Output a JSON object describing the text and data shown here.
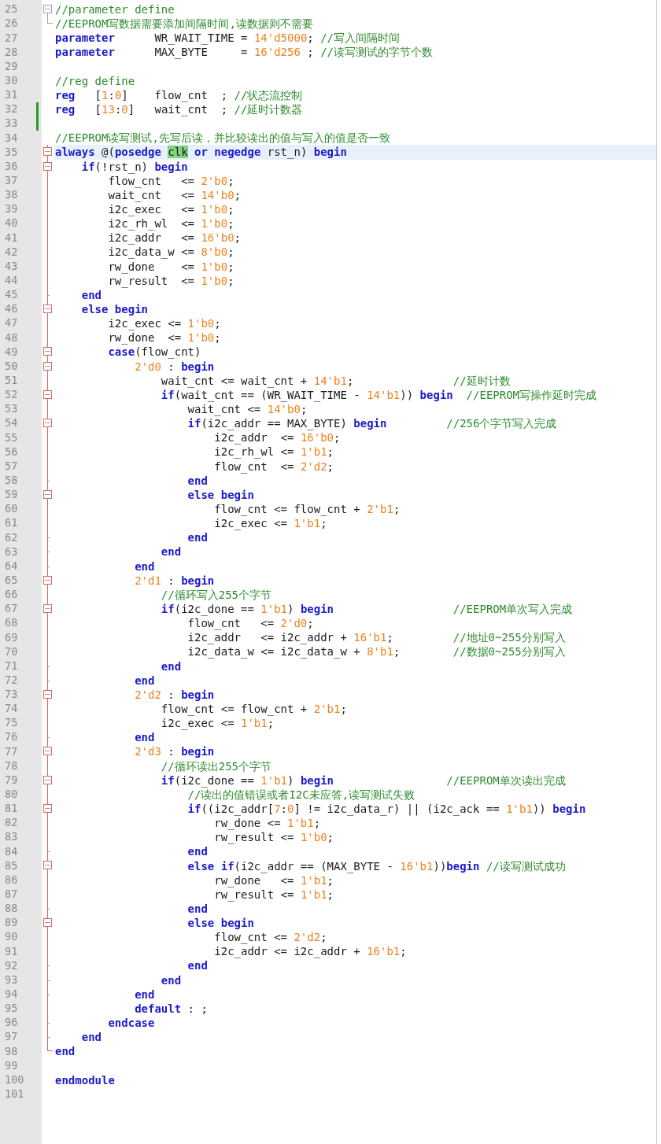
{
  "lines": [
    {
      "number": "25",
      "fold": {
        "kind": "box",
        "active": false
      },
      "changed": false,
      "current": false,
      "tokens": [
        {
          "kind": "comment",
          "text": "//parameter define"
        }
      ]
    },
    {
      "number": "26",
      "fold": {
        "kind": "corner",
        "active": false
      },
      "changed": false,
      "current": false,
      "tokens": [
        {
          "kind": "comment",
          "text": "//EEPROM写数据需要添加间隔时间,读数据则不需要"
        }
      ]
    },
    {
      "number": "27",
      "changed": false,
      "current": false,
      "tokens": [
        {
          "kind": "keyword",
          "text": "parameter"
        },
        {
          "kind": "plain",
          "text": "      WR_WAIT_TIME = "
        },
        {
          "kind": "number",
          "text": "14'd5000"
        },
        {
          "kind": "plain",
          "text": ";"
        },
        {
          "kind": "comment",
          "text": " //写入间隔时间"
        }
      ]
    },
    {
      "number": "28",
      "changed": false,
      "current": false,
      "tokens": [
        {
          "kind": "keyword",
          "text": "parameter"
        },
        {
          "kind": "plain",
          "text": "      MAX_BYTE     = "
        },
        {
          "kind": "number",
          "text": "16'd256"
        },
        {
          "kind": "plain",
          "text": " ;"
        },
        {
          "kind": "comment",
          "text": " //读写测试的字节个数"
        }
      ]
    },
    {
      "number": "29",
      "changed": false,
      "current": false
    },
    {
      "number": "30",
      "changed": false,
      "current": false,
      "tokens": [
        {
          "kind": "comment",
          "text": "//reg define"
        }
      ]
    },
    {
      "number": "31",
      "changed": false,
      "current": false,
      "tokens": [
        {
          "kind": "keyword",
          "text": "reg"
        },
        {
          "kind": "plain",
          "text": "   ["
        },
        {
          "kind": "number",
          "text": "1"
        },
        {
          "kind": "plain",
          "text": ":"
        },
        {
          "kind": "number",
          "text": "0"
        },
        {
          "kind": "plain",
          "text": "]    flow_cnt  ;"
        },
        {
          "kind": "comment",
          "text": " //状态流控制"
        }
      ]
    },
    {
      "number": "32",
      "changed": true,
      "current": false,
      "tokens": [
        {
          "kind": "keyword",
          "text": "reg"
        },
        {
          "kind": "plain",
          "text": "   ["
        },
        {
          "kind": "number",
          "text": "13"
        },
        {
          "kind": "plain",
          "text": ":"
        },
        {
          "kind": "number",
          "text": "0"
        },
        {
          "kind": "plain",
          "text": "]   wait_cnt  ;"
        },
        {
          "kind": "comment",
          "text": " //延时计数器"
        }
      ]
    },
    {
      "number": "33",
      "changed": true,
      "current": false
    },
    {
      "number": "34",
      "changed": false,
      "current": false,
      "tokens": [
        {
          "kind": "comment",
          "text": "//EEPROM读写测试,先写后读，并比较读出的值与写入的值是否一致"
        }
      ]
    },
    {
      "number": "35",
      "fold": {
        "kind": "box",
        "active": true
      },
      "changed": false,
      "current": true,
      "tokens": [
        {
          "kind": "keyword",
          "text": "always"
        },
        {
          "kind": "plain",
          "text": " @("
        },
        {
          "kind": "keyword",
          "text": "posedge "
        },
        {
          "kind": "match",
          "text": "clk"
        },
        {
          "kind": "keyword",
          "text": " or negedge"
        },
        {
          "kind": "plain",
          "text": " rst_n) "
        },
        {
          "kind": "keyword",
          "text": "begin"
        }
      ]
    },
    {
      "number": "36",
      "fold": {
        "kind": "box",
        "active": true
      },
      "changed": false,
      "current": false,
      "tokens": [
        {
          "kind": "keyword",
          "text": "    if"
        },
        {
          "kind": "plain",
          "text": "(!rst_n) "
        },
        {
          "kind": "keyword",
          "text": "begin"
        }
      ]
    },
    {
      "number": "37",
      "fold": {
        "kind": "bar",
        "active": true
      },
      "changed": false,
      "current": false,
      "tokens": [
        {
          "kind": "plain",
          "text": "        flow_cnt   <= "
        },
        {
          "kind": "number",
          "text": "2'b0"
        },
        {
          "kind": "plain",
          "text": ";"
        }
      ]
    },
    {
      "number": "38",
      "fold": {
        "kind": "bar",
        "active": true
      },
      "changed": false,
      "current": false,
      "tokens": [
        {
          "kind": "plain",
          "text": "        wait_cnt   <= "
        },
        {
          "kind": "number",
          "text": "14'b0"
        },
        {
          "kind": "plain",
          "text": ";"
        }
      ]
    },
    {
      "number": "39",
      "fold": {
        "kind": "bar",
        "active": true
      },
      "changed": false,
      "current": false,
      "tokens": [
        {
          "kind": "plain",
          "text": "        i2c_exec   <= "
        },
        {
          "kind": "number",
          "text": "1'b0"
        },
        {
          "kind": "plain",
          "text": ";"
        }
      ]
    },
    {
      "number": "40",
      "fold": {
        "kind": "bar",
        "active": true
      },
      "changed": false,
      "current": false,
      "tokens": [
        {
          "kind": "plain",
          "text": "        i2c_rh_wl  <= "
        },
        {
          "kind": "number",
          "text": "1'b0"
        },
        {
          "kind": "plain",
          "text": ";"
        }
      ]
    },
    {
      "number": "41",
      "fold": {
        "kind": "bar",
        "active": true
      },
      "changed": false,
      "current": false,
      "tokens": [
        {
          "kind": "plain",
          "text": "        i2c_addr   <= "
        },
        {
          "kind": "number",
          "text": "16'b0"
        },
        {
          "kind": "plain",
          "text": ";"
        }
      ]
    },
    {
      "number": "42",
      "fold": {
        "kind": "bar",
        "active": true
      },
      "changed": false,
      "current": false,
      "tokens": [
        {
          "kind": "plain",
          "text": "        i2c_data_w <= "
        },
        {
          "kind": "number",
          "text": "8'b0"
        },
        {
          "kind": "plain",
          "text": ";"
        }
      ]
    },
    {
      "number": "43",
      "fold": {
        "kind": "bar",
        "active": true
      },
      "changed": false,
      "current": false,
      "tokens": [
        {
          "kind": "plain",
          "text": "        rw_done    <= "
        },
        {
          "kind": "number",
          "text": "1'b0"
        },
        {
          "kind": "plain",
          "text": ";"
        }
      ]
    },
    {
      "number": "44",
      "fold": {
        "kind": "bar",
        "active": true
      },
      "changed": false,
      "current": false,
      "tokens": [
        {
          "kind": "plain",
          "text": "        rw_result  <= "
        },
        {
          "kind": "number",
          "text": "1'b0"
        },
        {
          "kind": "plain",
          "text": ";"
        }
      ]
    },
    {
      "number": "45",
      "fold": {
        "kind": "end",
        "active": true
      },
      "changed": false,
      "current": false,
      "tokens": [
        {
          "kind": "keyword",
          "text": "    end"
        }
      ]
    },
    {
      "number": "46",
      "fold": {
        "kind": "box",
        "active": true
      },
      "changed": false,
      "current": false,
      "tokens": [
        {
          "kind": "keyword",
          "text": "    else begin"
        }
      ]
    },
    {
      "number": "47",
      "fold": {
        "kind": "bar",
        "active": true
      },
      "changed": false,
      "current": false,
      "tokens": [
        {
          "kind": "plain",
          "text": "        i2c_exec <= "
        },
        {
          "kind": "number",
          "text": "1'b0"
        },
        {
          "kind": "plain",
          "text": ";"
        }
      ]
    },
    {
      "number": "48",
      "fold": {
        "kind": "bar",
        "active": true
      },
      "changed": false,
      "current": false,
      "tokens": [
        {
          "kind": "plain",
          "text": "        rw_done  <= "
        },
        {
          "kind": "number",
          "text": "1'b0"
        },
        {
          "kind": "plain",
          "text": ";"
        }
      ]
    },
    {
      "number": "49",
      "fold": {
        "kind": "box",
        "active": true
      },
      "changed": false,
      "current": false,
      "tokens": [
        {
          "kind": "keyword",
          "text": "        case"
        },
        {
          "kind": "plain",
          "text": "(flow_cnt)"
        }
      ]
    },
    {
      "number": "50",
      "fold": {
        "kind": "box",
        "active": true
      },
      "changed": false,
      "current": false,
      "tokens": [
        {
          "kind": "number",
          "text": "            2'd0"
        },
        {
          "kind": "plain",
          "text": " : "
        },
        {
          "kind": "keyword",
          "text": "begin"
        }
      ]
    },
    {
      "number": "51",
      "fold": {
        "kind": "bar",
        "active": true
      },
      "changed": false,
      "current": false,
      "tokens": [
        {
          "kind": "plain",
          "text": "                wait_cnt <= wait_cnt + "
        },
        {
          "kind": "number",
          "text": "14'b1"
        },
        {
          "kind": "plain",
          "text": ";"
        },
        {
          "kind": "comment",
          "text": "               //延时计数"
        }
      ]
    },
    {
      "number": "52",
      "fold": {
        "kind": "box",
        "active": true
      },
      "changed": false,
      "current": false,
      "tokens": [
        {
          "kind": "keyword",
          "text": "                if"
        },
        {
          "kind": "plain",
          "text": "(wait_cnt == (WR_WAIT_TIME - "
        },
        {
          "kind": "number",
          "text": "14'b1"
        },
        {
          "kind": "plain",
          "text": ")) "
        },
        {
          "kind": "keyword",
          "text": "begin"
        },
        {
          "kind": "comment",
          "text": "  //EEPROM写操作延时完成"
        }
      ]
    },
    {
      "number": "53",
      "fold": {
        "kind": "bar",
        "active": true
      },
      "changed": false,
      "current": false,
      "tokens": [
        {
          "kind": "plain",
          "text": "                    wait_cnt <= "
        },
        {
          "kind": "number",
          "text": "14'b0"
        },
        {
          "kind": "plain",
          "text": ";"
        }
      ]
    },
    {
      "number": "54",
      "fold": {
        "kind": "box",
        "active": true
      },
      "changed": false,
      "current": false,
      "tokens": [
        {
          "kind": "keyword",
          "text": "                    if"
        },
        {
          "kind": "plain",
          "text": "(i2c_addr == MAX_BYTE) "
        },
        {
          "kind": "keyword",
          "text": "begin"
        },
        {
          "kind": "comment",
          "text": "         //256个字节写入完成"
        }
      ]
    },
    {
      "number": "55",
      "fold": {
        "kind": "bar",
        "active": true
      },
      "changed": false,
      "current": false,
      "tokens": [
        {
          "kind": "plain",
          "text": "                        i2c_addr  <= "
        },
        {
          "kind": "number",
          "text": "16'b0"
        },
        {
          "kind": "plain",
          "text": ";"
        }
      ]
    },
    {
      "number": "56",
      "fold": {
        "kind": "bar",
        "active": true
      },
      "changed": false,
      "current": false,
      "tokens": [
        {
          "kind": "plain",
          "text": "                        i2c_rh_wl <= "
        },
        {
          "kind": "number",
          "text": "1'b1"
        },
        {
          "kind": "plain",
          "text": ";"
        }
      ]
    },
    {
      "number": "57",
      "fold": {
        "kind": "bar",
        "active": true
      },
      "changed": false,
      "current": false,
      "tokens": [
        {
          "kind": "plain",
          "text": "                        flow_cnt  <= "
        },
        {
          "kind": "number",
          "text": "2'd2"
        },
        {
          "kind": "plain",
          "text": ";"
        }
      ]
    },
    {
      "number": "58",
      "fold": {
        "kind": "end",
        "active": true
      },
      "changed": false,
      "current": false,
      "tokens": [
        {
          "kind": "keyword",
          "text": "                    end"
        }
      ]
    },
    {
      "number": "59",
      "fold": {
        "kind": "box",
        "active": true
      },
      "changed": false,
      "current": false,
      "tokens": [
        {
          "kind": "keyword",
          "text": "                    else begin"
        }
      ]
    },
    {
      "number": "60",
      "fold": {
        "kind": "bar",
        "active": true
      },
      "changed": false,
      "current": false,
      "tokens": [
        {
          "kind": "plain",
          "text": "                        flow_cnt <= flow_cnt + "
        },
        {
          "kind": "number",
          "text": "2'b1"
        },
        {
          "kind": "plain",
          "text": ";"
        }
      ]
    },
    {
      "number": "61",
      "fold": {
        "kind": "bar",
        "active": true
      },
      "changed": false,
      "current": false,
      "tokens": [
        {
          "kind": "plain",
          "text": "                        i2c_exec <= "
        },
        {
          "kind": "number",
          "text": "1'b1"
        },
        {
          "kind": "plain",
          "text": ";"
        }
      ]
    },
    {
      "number": "62",
      "fold": {
        "kind": "end",
        "active": true
      },
      "changed": false,
      "current": false,
      "tokens": [
        {
          "kind": "keyword",
          "text": "                    end"
        }
      ]
    },
    {
      "number": "63",
      "fold": {
        "kind": "end",
        "active": true
      },
      "changed": false,
      "current": false,
      "tokens": [
        {
          "kind": "keyword",
          "text": "                end"
        }
      ]
    },
    {
      "number": "64",
      "fold": {
        "kind": "end",
        "active": true
      },
      "changed": false,
      "current": false,
      "tokens": [
        {
          "kind": "keyword",
          "text": "            end"
        }
      ]
    },
    {
      "number": "65",
      "fold": {
        "kind": "box",
        "active": true
      },
      "changed": false,
      "current": false,
      "tokens": [
        {
          "kind": "number",
          "text": "            2'd1"
        },
        {
          "kind": "plain",
          "text": " : "
        },
        {
          "kind": "keyword",
          "text": "begin"
        }
      ]
    },
    {
      "number": "66",
      "fold": {
        "kind": "bar",
        "active": true
      },
      "changed": false,
      "current": false,
      "tokens": [
        {
          "kind": "comment",
          "text": "                //循环写入255个字节"
        }
      ]
    },
    {
      "number": "67",
      "fold": {
        "kind": "box",
        "active": true
      },
      "changed": false,
      "current": false,
      "tokens": [
        {
          "kind": "keyword",
          "text": "                if"
        },
        {
          "kind": "plain",
          "text": "(i2c_done == "
        },
        {
          "kind": "number",
          "text": "1'b1"
        },
        {
          "kind": "plain",
          "text": ") "
        },
        {
          "kind": "keyword",
          "text": "begin"
        },
        {
          "kind": "comment",
          "text": "                  //EEPROM单次写入完成"
        }
      ]
    },
    {
      "number": "68",
      "fold": {
        "kind": "bar",
        "active": true
      },
      "changed": false,
      "current": false,
      "tokens": [
        {
          "kind": "plain",
          "text": "                    flow_cnt   <= "
        },
        {
          "kind": "number",
          "text": "2'd0"
        },
        {
          "kind": "plain",
          "text": ";"
        }
      ]
    },
    {
      "number": "69",
      "fold": {
        "kind": "bar",
        "active": true
      },
      "changed": false,
      "current": false,
      "tokens": [
        {
          "kind": "plain",
          "text": "                    i2c_addr   <= i2c_addr + "
        },
        {
          "kind": "number",
          "text": "16'b1"
        },
        {
          "kind": "plain",
          "text": ";"
        },
        {
          "kind": "comment",
          "text": "         //地址0~255分别写入"
        }
      ]
    },
    {
      "number": "70",
      "fold": {
        "kind": "bar",
        "active": true
      },
      "changed": false,
      "current": false,
      "tokens": [
        {
          "kind": "plain",
          "text": "                    i2c_data_w <= i2c_data_w + "
        },
        {
          "kind": "number",
          "text": "8'b1"
        },
        {
          "kind": "plain",
          "text": ";"
        },
        {
          "kind": "comment",
          "text": "        //数据0~255分别写入"
        }
      ]
    },
    {
      "number": "71",
      "fold": {
        "kind": "end",
        "active": true
      },
      "changed": false,
      "current": false,
      "tokens": [
        {
          "kind": "keyword",
          "text": "                end"
        }
      ]
    },
    {
      "number": "72",
      "fold": {
        "kind": "end",
        "active": true
      },
      "changed": false,
      "current": false,
      "tokens": [
        {
          "kind": "keyword",
          "text": "            end"
        }
      ]
    },
    {
      "number": "73",
      "fold": {
        "kind": "box",
        "active": true
      },
      "changed": false,
      "current": false,
      "tokens": [
        {
          "kind": "number",
          "text": "            2'd2"
        },
        {
          "kind": "plain",
          "text": " : "
        },
        {
          "kind": "keyword",
          "text": "begin"
        }
      ]
    },
    {
      "number": "74",
      "fold": {
        "kind": "bar",
        "active": true
      },
      "changed": false,
      "current": false,
      "tokens": [
        {
          "kind": "plain",
          "text": "                flow_cnt <= flow_cnt + "
        },
        {
          "kind": "number",
          "text": "2'b1"
        },
        {
          "kind": "plain",
          "text": ";"
        }
      ]
    },
    {
      "number": "75",
      "fold": {
        "kind": "bar",
        "active": true
      },
      "changed": false,
      "current": false,
      "tokens": [
        {
          "kind": "plain",
          "text": "                i2c_exec <= "
        },
        {
          "kind": "number",
          "text": "1'b1"
        },
        {
          "kind": "plain",
          "text": ";"
        }
      ]
    },
    {
      "number": "76",
      "fold": {
        "kind": "end",
        "active": true
      },
      "changed": false,
      "current": false,
      "tokens": [
        {
          "kind": "keyword",
          "text": "            end"
        }
      ]
    },
    {
      "number": "77",
      "fold": {
        "kind": "box",
        "active": true
      },
      "changed": false,
      "current": false,
      "tokens": [
        {
          "kind": "number",
          "text": "            2'd3"
        },
        {
          "kind": "plain",
          "text": " : "
        },
        {
          "kind": "keyword",
          "text": "begin"
        }
      ]
    },
    {
      "number": "78",
      "fold": {
        "kind": "bar",
        "active": true
      },
      "changed": false,
      "current": false,
      "tokens": [
        {
          "kind": "comment",
          "text": "                //循环读出255个字节"
        }
      ]
    },
    {
      "number": "79",
      "fold": {
        "kind": "box",
        "active": true
      },
      "changed": false,
      "current": false,
      "tokens": [
        {
          "kind": "keyword",
          "text": "                if"
        },
        {
          "kind": "plain",
          "text": "(i2c_done == "
        },
        {
          "kind": "number",
          "text": "1'b1"
        },
        {
          "kind": "plain",
          "text": ") "
        },
        {
          "kind": "keyword",
          "text": "begin"
        },
        {
          "kind": "comment",
          "text": "                 //EEPROM单次读出完成"
        }
      ]
    },
    {
      "number": "80",
      "fold": {
        "kind": "bar",
        "active": true
      },
      "changed": false,
      "current": false,
      "tokens": [
        {
          "kind": "comment",
          "text": "                    //读出的值错误或者I2C未应答,读写测试失败"
        }
      ]
    },
    {
      "number": "81",
      "fold": {
        "kind": "box",
        "active": true
      },
      "changed": false,
      "current": false,
      "tokens": [
        {
          "kind": "keyword",
          "text": "                    if"
        },
        {
          "kind": "plain",
          "text": "((i2c_addr["
        },
        {
          "kind": "number",
          "text": "7"
        },
        {
          "kind": "plain",
          "text": ":"
        },
        {
          "kind": "number",
          "text": "0"
        },
        {
          "kind": "plain",
          "text": "] != i2c_data_r) || (i2c_ack == "
        },
        {
          "kind": "number",
          "text": "1'b1"
        },
        {
          "kind": "plain",
          "text": ")) "
        },
        {
          "kind": "keyword",
          "text": "begin"
        }
      ]
    },
    {
      "number": "82",
      "fold": {
        "kind": "bar",
        "active": true
      },
      "changed": false,
      "current": false,
      "tokens": [
        {
          "kind": "plain",
          "text": "                        rw_done <= "
        },
        {
          "kind": "number",
          "text": "1'b1"
        },
        {
          "kind": "plain",
          "text": ";"
        }
      ]
    },
    {
      "number": "83",
      "fold": {
        "kind": "bar",
        "active": true
      },
      "changed": false,
      "current": false,
      "tokens": [
        {
          "kind": "plain",
          "text": "                        rw_result <= "
        },
        {
          "kind": "number",
          "text": "1'b0"
        },
        {
          "kind": "plain",
          "text": ";"
        }
      ]
    },
    {
      "number": "84",
      "fold": {
        "kind": "end",
        "active": true
      },
      "changed": false,
      "current": false,
      "tokens": [
        {
          "kind": "keyword",
          "text": "                    end"
        }
      ]
    },
    {
      "number": "85",
      "fold": {
        "kind": "box",
        "active": true
      },
      "changed": false,
      "current": false,
      "tokens": [
        {
          "kind": "keyword",
          "text": "                    else if"
        },
        {
          "kind": "plain",
          "text": "(i2c_addr == (MAX_BYTE - "
        },
        {
          "kind": "number",
          "text": "16'b1"
        },
        {
          "kind": "plain",
          "text": "))"
        },
        {
          "kind": "keyword",
          "text": "begin"
        },
        {
          "kind": "comment",
          "text": " //读写测试成功"
        }
      ]
    },
    {
      "number": "86",
      "fold": {
        "kind": "bar",
        "active": true
      },
      "changed": false,
      "current": false,
      "tokens": [
        {
          "kind": "plain",
          "text": "                        rw_done   <= "
        },
        {
          "kind": "number",
          "text": "1'b1"
        },
        {
          "kind": "plain",
          "text": ";"
        }
      ]
    },
    {
      "number": "87",
      "fold": {
        "kind": "bar",
        "active": true
      },
      "changed": false,
      "current": false,
      "tokens": [
        {
          "kind": "plain",
          "text": "                        rw_result <= "
        },
        {
          "kind": "number",
          "text": "1'b1"
        },
        {
          "kind": "plain",
          "text": ";"
        }
      ]
    },
    {
      "number": "88",
      "fold": {
        "kind": "end",
        "active": true
      },
      "changed": false,
      "current": false,
      "tokens": [
        {
          "kind": "keyword",
          "text": "                    end"
        }
      ]
    },
    {
      "number": "89",
      "fold": {
        "kind": "box",
        "active": true
      },
      "changed": false,
      "current": false,
      "tokens": [
        {
          "kind": "keyword",
          "text": "                    else begin"
        }
      ]
    },
    {
      "number": "90",
      "fold": {
        "kind": "bar",
        "active": true
      },
      "changed": false,
      "current": false,
      "tokens": [
        {
          "kind": "plain",
          "text": "                        flow_cnt <= "
        },
        {
          "kind": "number",
          "text": "2'd2"
        },
        {
          "kind": "plain",
          "text": ";"
        }
      ]
    },
    {
      "number": "91",
      "fold": {
        "kind": "bar",
        "active": true
      },
      "changed": false,
      "current": false,
      "tokens": [
        {
          "kind": "plain",
          "text": "                        i2c_addr <= i2c_addr + "
        },
        {
          "kind": "number",
          "text": "16'b1"
        },
        {
          "kind": "plain",
          "text": ";"
        }
      ]
    },
    {
      "number": "92",
      "fold": {
        "kind": "end",
        "active": true
      },
      "changed": false,
      "current": false,
      "tokens": [
        {
          "kind": "keyword",
          "text": "                    end"
        }
      ]
    },
    {
      "number": "93",
      "fold": {
        "kind": "end",
        "active": true
      },
      "changed": false,
      "current": false,
      "tokens": [
        {
          "kind": "keyword",
          "text": "                end"
        }
      ]
    },
    {
      "number": "94",
      "fold": {
        "kind": "end",
        "active": true
      },
      "changed": false,
      "current": false,
      "tokens": [
        {
          "kind": "keyword",
          "text": "            end"
        }
      ]
    },
    {
      "number": "95",
      "fold": {
        "kind": "bar",
        "active": true
      },
      "changed": false,
      "current": false,
      "tokens": [
        {
          "kind": "keyword",
          "text": "            default"
        },
        {
          "kind": "plain",
          "text": " : ;"
        }
      ]
    },
    {
      "number": "96",
      "fold": {
        "kind": "end",
        "active": true
      },
      "changed": false,
      "current": false,
      "tokens": [
        {
          "kind": "keyword",
          "text": "        endcase"
        }
      ]
    },
    {
      "number": "97",
      "fold": {
        "kind": "end",
        "active": true
      },
      "changed": false,
      "current": false,
      "tokens": [
        {
          "kind": "keyword",
          "text": "    end"
        }
      ]
    },
    {
      "number": "98",
      "fold": {
        "kind": "corner",
        "active": true
      },
      "changed": false,
      "current": false,
      "tokens": [
        {
          "kind": "keyword",
          "text": "end"
        }
      ]
    },
    {
      "number": "99",
      "changed": false,
      "current": false
    },
    {
      "number": "100",
      "changed": false,
      "current": false,
      "tokens": [
        {
          "kind": "keyword",
          "text": "endmodule"
        }
      ]
    },
    {
      "number": "101",
      "changed": false,
      "current": false
    }
  ]
}
